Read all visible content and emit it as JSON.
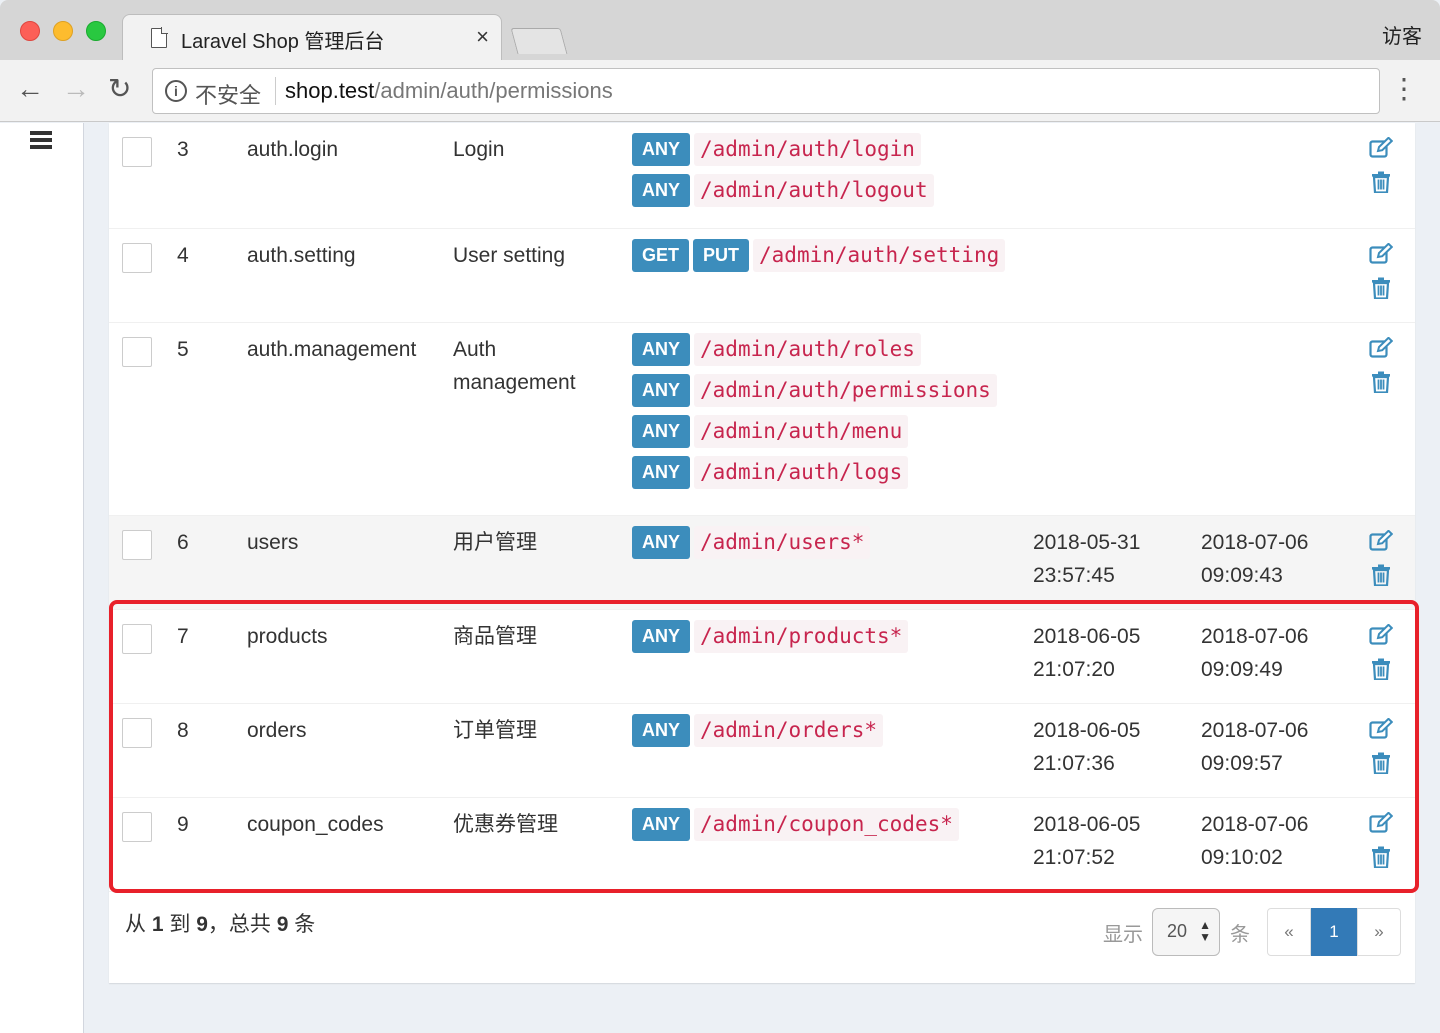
{
  "browser": {
    "tab_title": "Laravel Shop 管理后台",
    "tab_close": "×",
    "profile": "访客",
    "security_label": "不安全",
    "url_host": "shop.test",
    "url_path": "/admin/auth/permissions",
    "back": "←",
    "forward": "→",
    "reload": "↻",
    "menu": "⋮"
  },
  "rows": [
    {
      "id": "3",
      "slug": "auth.login",
      "name": "Login",
      "created": "",
      "updated": "",
      "routes": [
        {
          "methods": [
            "ANY"
          ],
          "path": "/admin/auth/login"
        },
        {
          "methods": [
            "ANY"
          ],
          "path": "/admin/auth/logout"
        }
      ]
    },
    {
      "id": "4",
      "slug": "auth.setting",
      "name": "User setting",
      "created": "",
      "updated": "",
      "routes": [
        {
          "methods": [
            "GET",
            "PUT"
          ],
          "path": "/admin/auth/setting"
        }
      ]
    },
    {
      "id": "5",
      "slug": "auth.management",
      "name": "Auth management",
      "created": "",
      "updated": "",
      "routes": [
        {
          "methods": [
            "ANY"
          ],
          "path": "/admin/auth/roles"
        },
        {
          "methods": [
            "ANY"
          ],
          "path": "/admin/auth/permissions"
        },
        {
          "methods": [
            "ANY"
          ],
          "path": "/admin/auth/menu"
        },
        {
          "methods": [
            "ANY"
          ],
          "path": "/admin/auth/logs"
        }
      ]
    },
    {
      "id": "6",
      "slug": "users",
      "name": "用户管理",
      "created": "2018-05-31 23:57:45",
      "updated": "2018-07-06 09:09:43",
      "routes": [
        {
          "methods": [
            "ANY"
          ],
          "path": "/admin/users*"
        }
      ]
    },
    {
      "id": "7",
      "slug": "products",
      "name": "商品管理",
      "created": "2018-06-05 21:07:20",
      "updated": "2018-07-06 09:09:49",
      "routes": [
        {
          "methods": [
            "ANY"
          ],
          "path": "/admin/products*"
        }
      ]
    },
    {
      "id": "8",
      "slug": "orders",
      "name": "订单管理",
      "created": "2018-06-05 21:07:36",
      "updated": "2018-07-06 09:09:57",
      "routes": [
        {
          "methods": [
            "ANY"
          ],
          "path": "/admin/orders*"
        }
      ]
    },
    {
      "id": "9",
      "slug": "coupon_codes",
      "name": "优惠券管理",
      "created": "2018-06-05 21:07:52",
      "updated": "2018-07-06 09:10:02",
      "routes": [
        {
          "methods": [
            "ANY"
          ],
          "path": "/admin/coupon_codes*"
        }
      ]
    }
  ],
  "footer": {
    "summary_from": "从",
    "summary_first": "1",
    "summary_to": "到",
    "summary_last": "9",
    "summary_total_label": "，总共",
    "summary_total": "9",
    "summary_unit": "条",
    "per_page_label": "显示",
    "per_page_value": "20",
    "per_page_unit": "条",
    "pager_prev": "«",
    "pager_current": "1",
    "pager_next": "»"
  },
  "colors": {
    "method_badge": "#3c8dbc",
    "route_path_text": "#c7254e",
    "route_path_bg": "#f9f2f4",
    "highlight_border": "#e8202a",
    "pager_active": "#337ab7"
  }
}
